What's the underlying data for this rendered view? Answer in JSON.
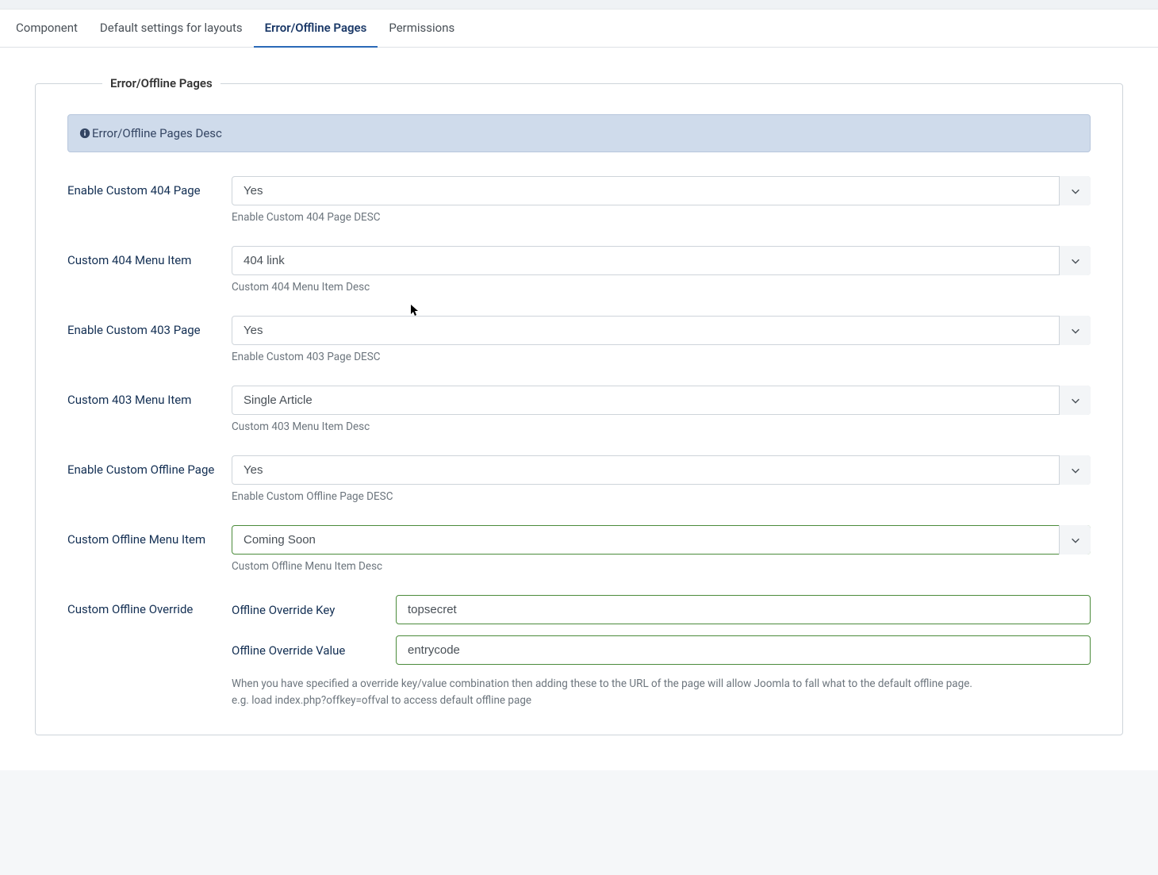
{
  "tabs": {
    "items": [
      {
        "label": "Component",
        "active": false
      },
      {
        "label": "Default settings for layouts",
        "active": false
      },
      {
        "label": "Error/Offline Pages",
        "active": true
      },
      {
        "label": "Permissions",
        "active": false
      }
    ]
  },
  "fieldset": {
    "legend": "Error/Offline Pages",
    "alert": "Error/Offline Pages Desc"
  },
  "fields": {
    "enable_404": {
      "label": "Enable Custom 404 Page",
      "value": "Yes",
      "desc": "Enable Custom 404 Page DESC"
    },
    "custom_404_menu": {
      "label": "Custom 404 Menu Item",
      "value": "404 link",
      "desc": "Custom 404 Menu Item Desc"
    },
    "enable_403": {
      "label": "Enable Custom 403 Page",
      "value": "Yes",
      "desc": "Enable Custom 403 Page DESC"
    },
    "custom_403_menu": {
      "label": "Custom 403 Menu Item",
      "value": "Single Article",
      "desc": "Custom 403 Menu Item Desc"
    },
    "enable_offline": {
      "label": "Enable Custom Offline Page",
      "value": "Yes",
      "desc": "Enable Custom Offline Page DESC"
    },
    "custom_offline_menu": {
      "label": "Custom Offline Menu Item",
      "value": "Coming Soon",
      "desc": "Custom Offline Menu Item Desc"
    },
    "offline_override": {
      "label": "Custom Offline Override",
      "key_label": "Offline Override Key",
      "key_value": "topsecret",
      "val_label": "Offline Override Value",
      "val_value": "entrycode",
      "note_line1": "When you have specified a override key/value combination then adding these to the URL of the page will allow Joomla to fall what to the default offline page.",
      "note_line2": "e.g. load index.php?offkey=offval to access default offline page"
    }
  }
}
